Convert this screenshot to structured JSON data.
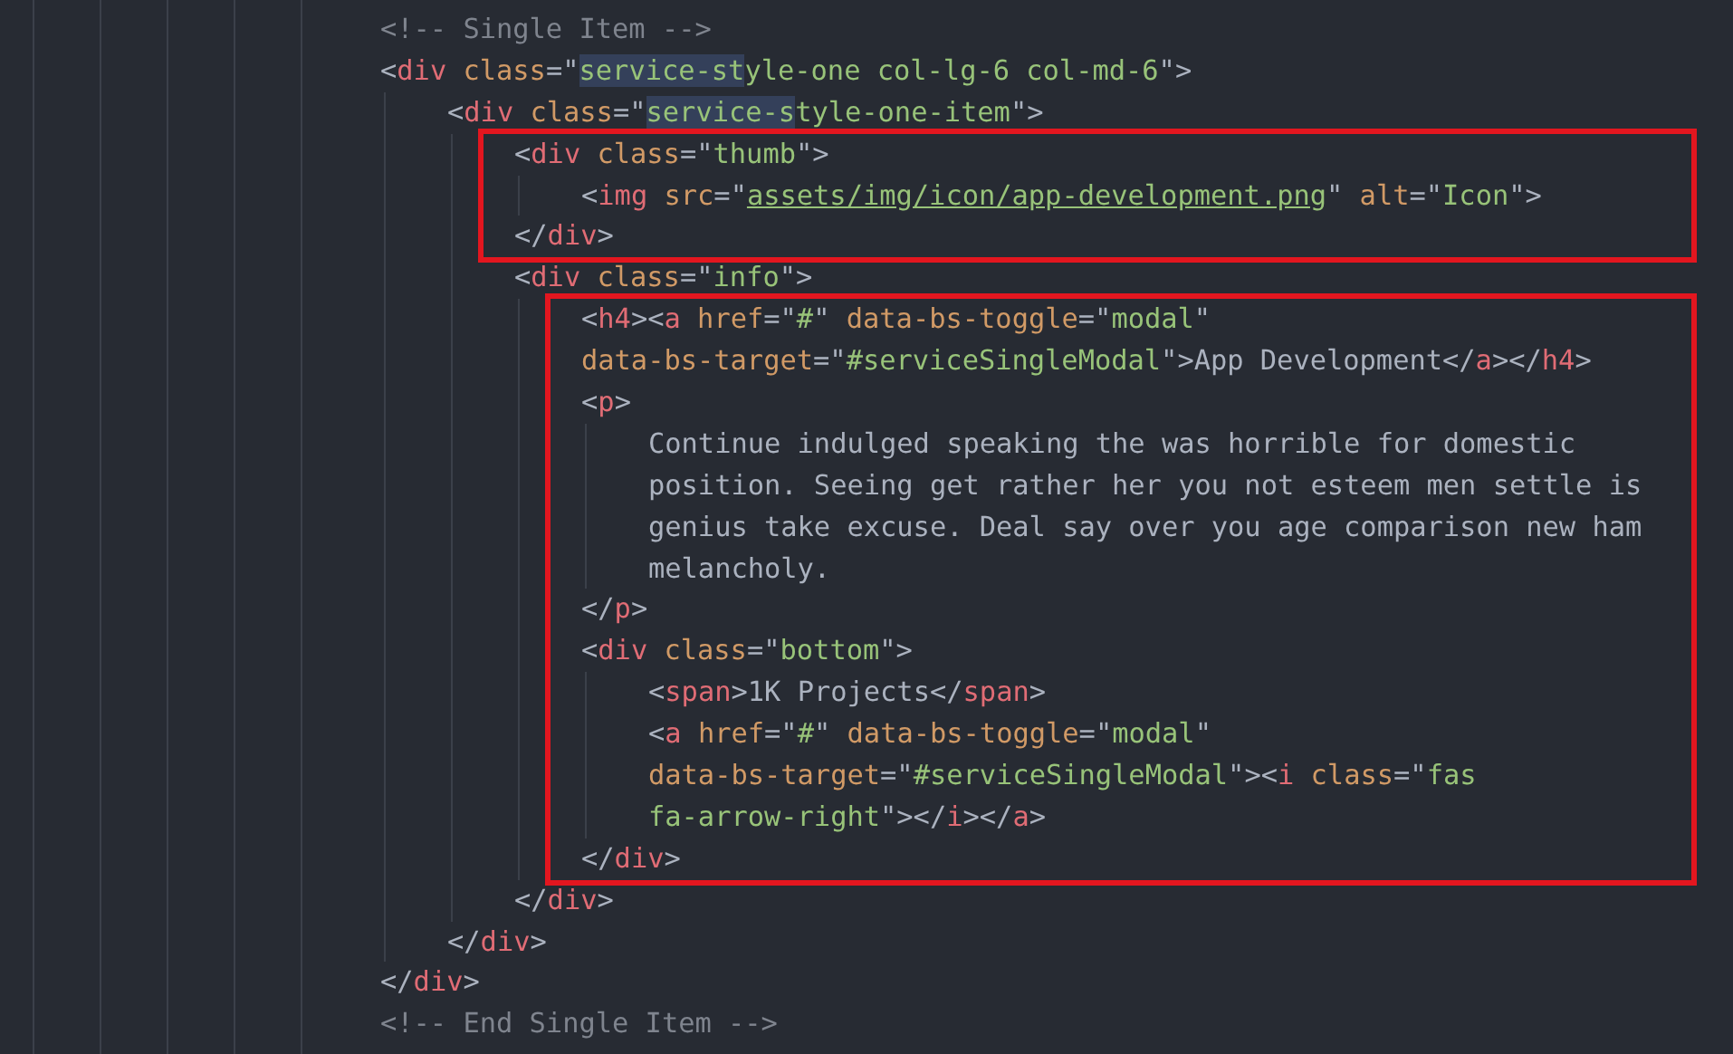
{
  "editor": {
    "lines": [
      {
        "kind": "line",
        "tokens": [
          {
            "kind": "comment",
            "text": "<!-- Single Item -->"
          }
        ]
      },
      {
        "kind": "line",
        "tokens": [
          {
            "kind": "punct",
            "text": "<"
          },
          {
            "kind": "tag",
            "text": "div"
          },
          {
            "kind": "attr",
            "text": " class"
          },
          {
            "kind": "punct",
            "text": "=\""
          },
          {
            "kind": "match",
            "text": "service-st"
          },
          {
            "kind": "string",
            "text": "yle-one col-lg-6 col-md-6"
          },
          {
            "kind": "punct",
            "text": "\">"
          }
        ],
        "children": [
          {
            "kind": "line",
            "tokens": [
              {
                "kind": "punct",
                "text": "<"
              },
              {
                "kind": "tag",
                "text": "div"
              },
              {
                "kind": "attr",
                "text": " class"
              },
              {
                "kind": "punct",
                "text": "=\""
              },
              {
                "kind": "match",
                "text": "service-s"
              },
              {
                "kind": "string",
                "text": "tyle-one-item"
              },
              {
                "kind": "punct",
                "text": "\">"
              }
            ],
            "children": [
              {
                "kind": "frame",
                "children": [
                  {
                    "kind": "line",
                    "tokens": [
                      {
                        "kind": "punct",
                        "text": "<"
                      },
                      {
                        "kind": "tag",
                        "text": "div"
                      },
                      {
                        "kind": "attr",
                        "text": " class"
                      },
                      {
                        "kind": "punct",
                        "text": "=\""
                      },
                      {
                        "kind": "string",
                        "text": "thumb"
                      },
                      {
                        "kind": "punct",
                        "text": "\">"
                      }
                    ],
                    "children": [
                      {
                        "kind": "line",
                        "tokens": [
                          {
                            "kind": "punct",
                            "text": "<"
                          },
                          {
                            "kind": "tag",
                            "text": "img"
                          },
                          {
                            "kind": "attr",
                            "text": " src"
                          },
                          {
                            "kind": "punct",
                            "text": "=\""
                          },
                          {
                            "kind": "link",
                            "text": "assets/img/icon/app-development.png"
                          },
                          {
                            "kind": "punct",
                            "text": "\""
                          },
                          {
                            "kind": "attr",
                            "text": " alt"
                          },
                          {
                            "kind": "punct",
                            "text": "=\""
                          },
                          {
                            "kind": "string",
                            "text": "Icon"
                          },
                          {
                            "kind": "punct",
                            "text": "\">"
                          }
                        ]
                      }
                    ]
                  },
                  {
                    "kind": "line",
                    "tokens": [
                      {
                        "kind": "punct",
                        "text": "</"
                      },
                      {
                        "kind": "tag",
                        "text": "div"
                      },
                      {
                        "kind": "punct",
                        "text": ">"
                      }
                    ]
                  }
                ]
              },
              {
                "kind": "line",
                "tokens": [
                  {
                    "kind": "punct",
                    "text": "<"
                  },
                  {
                    "kind": "tag",
                    "text": "div"
                  },
                  {
                    "kind": "attr",
                    "text": " class"
                  },
                  {
                    "kind": "punct",
                    "text": "=\""
                  },
                  {
                    "kind": "string",
                    "text": "info"
                  },
                  {
                    "kind": "punct",
                    "text": "\">"
                  }
                ],
                "children": [
                  {
                    "kind": "frame",
                    "children": [
                      {
                        "kind": "line",
                        "tokens": [
                          {
                            "kind": "punct",
                            "text": "<"
                          },
                          {
                            "kind": "tag",
                            "text": "h4"
                          },
                          {
                            "kind": "punct",
                            "text": "><"
                          },
                          {
                            "kind": "tag",
                            "text": "a"
                          },
                          {
                            "kind": "attr",
                            "text": " href"
                          },
                          {
                            "kind": "punct",
                            "text": "=\""
                          },
                          {
                            "kind": "string",
                            "text": "#"
                          },
                          {
                            "kind": "punct",
                            "text": "\""
                          },
                          {
                            "kind": "attr",
                            "text": " data-bs-toggle"
                          },
                          {
                            "kind": "punct",
                            "text": "=\""
                          },
                          {
                            "kind": "string",
                            "text": "modal"
                          },
                          {
                            "kind": "punct",
                            "text": "\""
                          }
                        ]
                      },
                      {
                        "kind": "line",
                        "tokens": [
                          {
                            "kind": "attr",
                            "text": "data-bs-target"
                          },
                          {
                            "kind": "punct",
                            "text": "=\""
                          },
                          {
                            "kind": "string",
                            "text": "#serviceSingleModal"
                          },
                          {
                            "kind": "punct",
                            "text": "\">"
                          },
                          {
                            "kind": "text",
                            "text": "App Development"
                          },
                          {
                            "kind": "punct",
                            "text": "</"
                          },
                          {
                            "kind": "tag",
                            "text": "a"
                          },
                          {
                            "kind": "punct",
                            "text": "></"
                          },
                          {
                            "kind": "tag",
                            "text": "h4"
                          },
                          {
                            "kind": "punct",
                            "text": ">"
                          }
                        ]
                      },
                      {
                        "kind": "line",
                        "tokens": [
                          {
                            "kind": "punct",
                            "text": "<"
                          },
                          {
                            "kind": "tag",
                            "text": "p"
                          },
                          {
                            "kind": "punct",
                            "text": ">"
                          }
                        ],
                        "children": [
                          {
                            "kind": "line",
                            "tokens": [
                              {
                                "kind": "text",
                                "text": "Continue indulged speaking the was horrible for domestic"
                              }
                            ]
                          },
                          {
                            "kind": "line",
                            "tokens": [
                              {
                                "kind": "text",
                                "text": "position. Seeing get rather her you not esteem men settle is"
                              }
                            ]
                          },
                          {
                            "kind": "line",
                            "tokens": [
                              {
                                "kind": "text",
                                "text": "genius take excuse. Deal say over you age comparison new ham"
                              }
                            ]
                          },
                          {
                            "kind": "line",
                            "tokens": [
                              {
                                "kind": "text",
                                "text": "melancholy."
                              }
                            ]
                          }
                        ]
                      },
                      {
                        "kind": "line",
                        "tokens": [
                          {
                            "kind": "punct",
                            "text": "</"
                          },
                          {
                            "kind": "tag",
                            "text": "p"
                          },
                          {
                            "kind": "punct",
                            "text": ">"
                          }
                        ]
                      },
                      {
                        "kind": "line",
                        "tokens": [
                          {
                            "kind": "punct",
                            "text": "<"
                          },
                          {
                            "kind": "tag",
                            "text": "div"
                          },
                          {
                            "kind": "attr",
                            "text": " class"
                          },
                          {
                            "kind": "punct",
                            "text": "=\""
                          },
                          {
                            "kind": "string",
                            "text": "bottom"
                          },
                          {
                            "kind": "punct",
                            "text": "\">"
                          }
                        ],
                        "children": [
                          {
                            "kind": "line",
                            "tokens": [
                              {
                                "kind": "punct",
                                "text": "<"
                              },
                              {
                                "kind": "tag",
                                "text": "span"
                              },
                              {
                                "kind": "punct",
                                "text": ">"
                              },
                              {
                                "kind": "text",
                                "text": "1K Projects"
                              },
                              {
                                "kind": "punct",
                                "text": "</"
                              },
                              {
                                "kind": "tag",
                                "text": "span"
                              },
                              {
                                "kind": "punct",
                                "text": ">"
                              }
                            ]
                          },
                          {
                            "kind": "line",
                            "tokens": [
                              {
                                "kind": "punct",
                                "text": "<"
                              },
                              {
                                "kind": "tag",
                                "text": "a"
                              },
                              {
                                "kind": "attr",
                                "text": " href"
                              },
                              {
                                "kind": "punct",
                                "text": "=\""
                              },
                              {
                                "kind": "string",
                                "text": "#"
                              },
                              {
                                "kind": "punct",
                                "text": "\""
                              },
                              {
                                "kind": "attr",
                                "text": " data-bs-toggle"
                              },
                              {
                                "kind": "punct",
                                "text": "=\""
                              },
                              {
                                "kind": "string",
                                "text": "modal"
                              },
                              {
                                "kind": "punct",
                                "text": "\""
                              }
                            ]
                          },
                          {
                            "kind": "line",
                            "tokens": [
                              {
                                "kind": "attr",
                                "text": "data-bs-target"
                              },
                              {
                                "kind": "punct",
                                "text": "=\""
                              },
                              {
                                "kind": "string",
                                "text": "#serviceSingleModal"
                              },
                              {
                                "kind": "punct",
                                "text": "\"><"
                              },
                              {
                                "kind": "tag",
                                "text": "i"
                              },
                              {
                                "kind": "attr",
                                "text": " class"
                              },
                              {
                                "kind": "punct",
                                "text": "=\""
                              },
                              {
                                "kind": "string",
                                "text": "fas"
                              }
                            ]
                          },
                          {
                            "kind": "line",
                            "tokens": [
                              {
                                "kind": "string",
                                "text": "fa-arrow-right"
                              },
                              {
                                "kind": "punct",
                                "text": "\"></"
                              },
                              {
                                "kind": "tag",
                                "text": "i"
                              },
                              {
                                "kind": "punct",
                                "text": "></"
                              },
                              {
                                "kind": "tag",
                                "text": "a"
                              },
                              {
                                "kind": "punct",
                                "text": ">"
                              }
                            ]
                          }
                        ]
                      },
                      {
                        "kind": "line",
                        "tokens": [
                          {
                            "kind": "punct",
                            "text": "</"
                          },
                          {
                            "kind": "tag",
                            "text": "div"
                          },
                          {
                            "kind": "punct",
                            "text": ">"
                          }
                        ]
                      }
                    ]
                  }
                ]
              },
              {
                "kind": "line",
                "tokens": [
                  {
                    "kind": "punct",
                    "text": "</"
                  },
                  {
                    "kind": "tag",
                    "text": "div"
                  },
                  {
                    "kind": "punct",
                    "text": ">"
                  }
                ]
              }
            ]
          },
          {
            "kind": "line",
            "tokens": [
              {
                "kind": "punct",
                "text": "</"
              },
              {
                "kind": "tag",
                "text": "div"
              },
              {
                "kind": "punct",
                "text": ">"
              }
            ]
          }
        ]
      },
      {
        "kind": "line",
        "tokens": [
          {
            "kind": "punct",
            "text": "</"
          },
          {
            "kind": "tag",
            "text": "div"
          },
          {
            "kind": "punct",
            "text": ">"
          }
        ]
      },
      {
        "kind": "line",
        "tokens": [
          {
            "kind": "comment",
            "text": "<!-- End Single Item -->"
          }
        ]
      }
    ]
  }
}
